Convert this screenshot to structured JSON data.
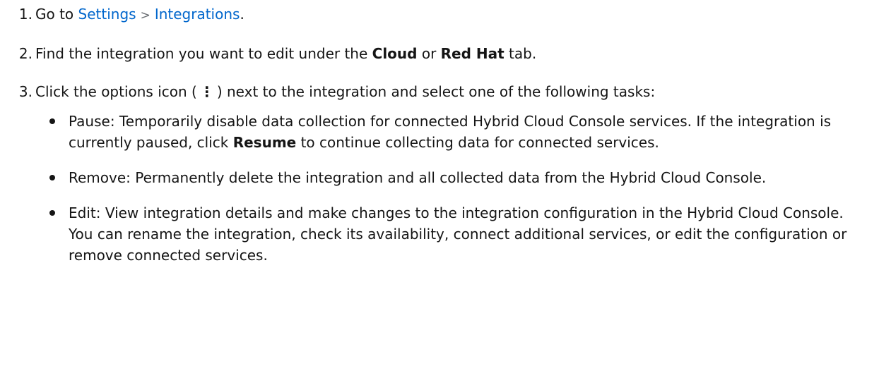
{
  "steps": [
    {
      "number": "1",
      "prefix": "Go to ",
      "link1": "Settings",
      "separator": ">",
      "link2": "Integrations",
      "suffix": "."
    },
    {
      "number": "2",
      "prefix": "Find the integration you want to edit under the ",
      "bold1": "Cloud",
      "middle": " or ",
      "bold2": "Red Hat",
      "suffix": " tab."
    },
    {
      "number": "3",
      "prefix": "Click the options icon (",
      "icon_glyph": "⋮",
      "suffix": ") next to the integration and select one of the following tasks:",
      "icon": "kebab-menu-icon"
    }
  ],
  "tasks": [
    {
      "term": "Pause",
      "text_before": ": Temporarily disable data collection for connected Hybrid Cloud Console services. If the integration is currently paused, click ",
      "bold": "Resume",
      "text_after": " to continue collecting data for connected services."
    },
    {
      "term": "Remove",
      "text": ": Permanently delete the integration and all collected data from the Hybrid Cloud Console."
    },
    {
      "term": "Edit",
      "text": ": View integration details and make changes to the integration configuration in the Hybrid Cloud Console. You can rename the integration, check its availability, connect additional services, or edit the configuration or remove connected services."
    }
  ],
  "colors": {
    "link": "#0066cc",
    "text": "#151515",
    "separator": "#6a6e73"
  }
}
